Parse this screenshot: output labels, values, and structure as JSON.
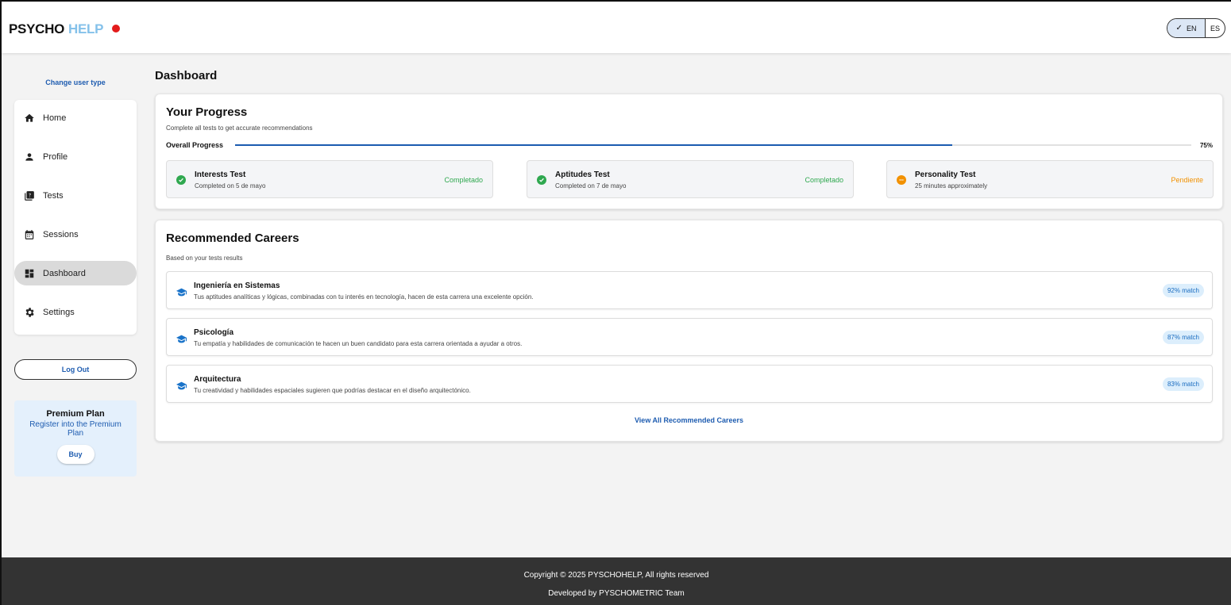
{
  "header": {
    "logo_part1": "PSYCHO",
    "logo_part2": "HELP",
    "lang_en": "EN",
    "lang_es": "ES",
    "active_lang": "EN"
  },
  "sidebar": {
    "change_user": "Change user type",
    "items": [
      {
        "label": "Home",
        "icon": "home-icon"
      },
      {
        "label": "Profile",
        "icon": "person-icon"
      },
      {
        "label": "Tests",
        "icon": "quiz-icon"
      },
      {
        "label": "Sessions",
        "icon": "calendar-icon"
      },
      {
        "label": "Dashboard",
        "icon": "dashboard-icon",
        "active": true
      },
      {
        "label": "Settings",
        "icon": "gear-icon"
      }
    ],
    "logout_label": "Log Out",
    "premium": {
      "title": "Premium Plan",
      "text": "Register into the Premium Plan",
      "buy_label": "Buy"
    }
  },
  "main": {
    "page_title": "Dashboard",
    "progress": {
      "title": "Your Progress",
      "subtitle": "Complete all tests to get accurate recommendations",
      "overall_label": "Overall Progress",
      "overall_value": 75,
      "overall_pct": "75%",
      "tests": [
        {
          "name": "Interests Test",
          "sub": "Completed on 5 de mayo",
          "status": "Completado",
          "state": "done"
        },
        {
          "name": "Aptitudes Test",
          "sub": "Completed on 7 de mayo",
          "status": "Completado",
          "state": "done"
        },
        {
          "name": "Personality Test",
          "sub": "25 minutes approximately",
          "status": "Pendiente",
          "state": "pending"
        }
      ]
    },
    "careers": {
      "title": "Recommended Careers",
      "subtitle": "Based on your tests results",
      "items": [
        {
          "name": "Ingeniería en Sistemas",
          "desc": "Tus aptitudes analíticas y lógicas, combinadas con tu interés en tecnología, hacen de esta carrera una excelente opción.",
          "match": "92% match"
        },
        {
          "name": "Psicología",
          "desc": "Tu empatía y habilidades de comunicación te hacen un buen candidato para esta carrera orientada a ayudar a otros.",
          "match": "87% match"
        },
        {
          "name": "Arquitectura",
          "desc": "Tu creatividad y habilidades espaciales sugieren que podrías destacar en el diseño arquitectónico.",
          "match": "83% match"
        }
      ],
      "view_all": "View All Recommended Careers"
    }
  },
  "footer": {
    "line1": "Copyright © 2025 PYSCHOHELP, All rights reserved",
    "line2": "Developed by PYSCHOMETRIC Team"
  },
  "colors": {
    "accent": "#1a5bb0",
    "done": "#2fa84f",
    "pending": "#f29100",
    "logo_help": "#84c1ea",
    "logo_dot": "#e31b1b"
  }
}
